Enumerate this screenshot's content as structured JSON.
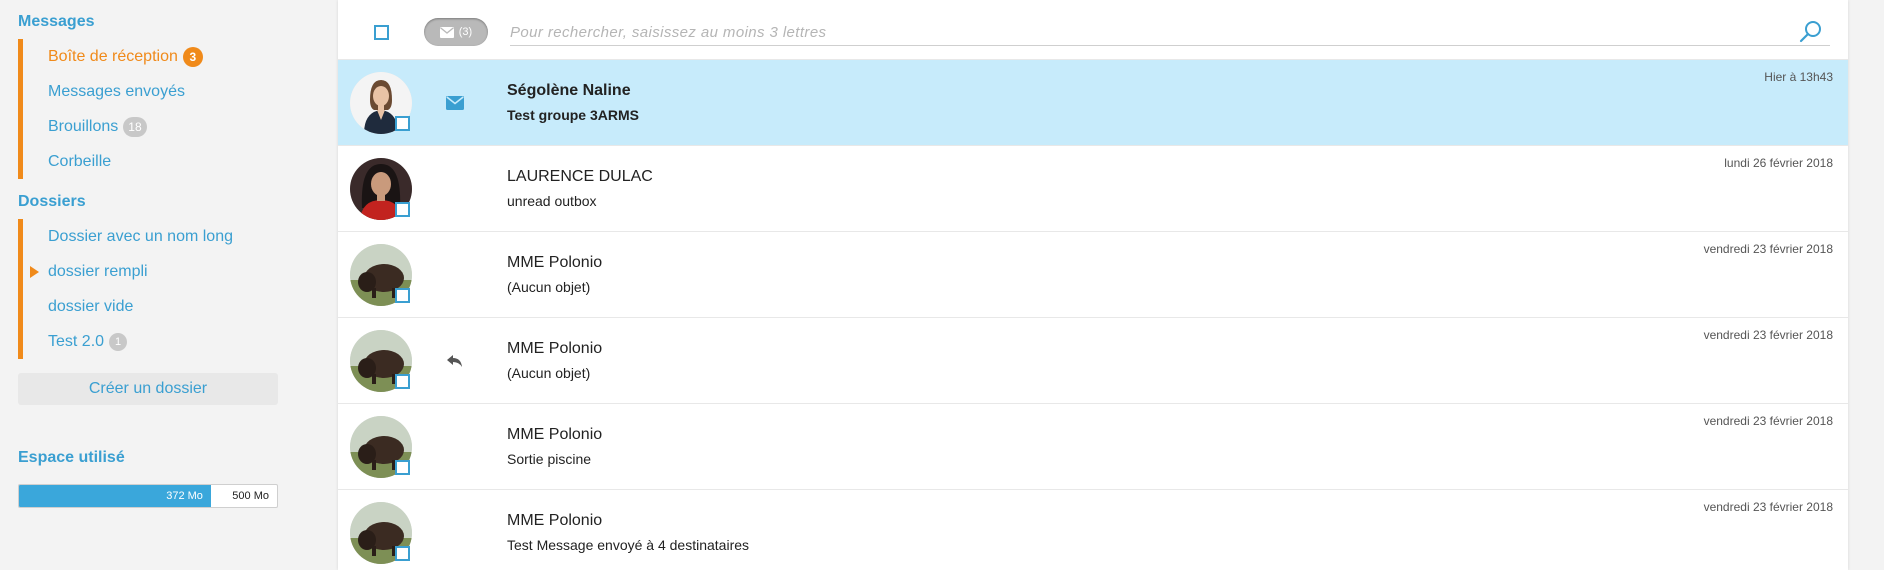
{
  "sidebar": {
    "messages_title": "Messages",
    "mail_items": [
      {
        "label": "Boîte de réception",
        "badge": "3"
      },
      {
        "label": "Messages envoyés",
        "badge": ""
      },
      {
        "label": "Brouillons",
        "badge": "18"
      },
      {
        "label": "Corbeille",
        "badge": ""
      }
    ],
    "folders_title": "Dossiers",
    "folder_items": [
      {
        "label": "Dossier avec un nom long",
        "badge": ""
      },
      {
        "label": "dossier rempli",
        "badge": ""
      },
      {
        "label": "dossier vide",
        "badge": ""
      },
      {
        "label": "Test 2.0",
        "badge": "1"
      }
    ],
    "create_folder_label": "Créer un dossier",
    "space_title": "Espace utilisé",
    "quota": {
      "used_label": "372 Mo",
      "total_label": "500 Mo",
      "used_fraction": 0.744
    }
  },
  "toolbar": {
    "unread_count": "(3)",
    "search_placeholder": "Pour rechercher, saisissez au moins 3 lettres",
    "search_value": ""
  },
  "messages": [
    {
      "sender": "Ségolène Naline",
      "subject": "Test groupe 3ARMS",
      "date": "Hier à 13h43",
      "status_icon": "envelope-icon",
      "avatar": "woman-portrait",
      "unread": true,
      "selected": true
    },
    {
      "sender": "LAURENCE DULAC",
      "subject": "unread outbox",
      "date": "lundi 26 février 2018",
      "status_icon": "",
      "avatar": "woman-dark-hair",
      "unread": false,
      "selected": false
    },
    {
      "sender": "MME Polonio",
      "subject": "(Aucun objet)",
      "date": "vendredi 23 février 2018",
      "status_icon": "",
      "avatar": "bison",
      "unread": false,
      "selected": false
    },
    {
      "sender": "MME Polonio",
      "subject": "(Aucun objet)",
      "date": "vendredi 23 février 2018",
      "status_icon": "reply-icon",
      "avatar": "bison",
      "unread": false,
      "selected": false
    },
    {
      "sender": "MME Polonio",
      "subject": "Sortie piscine",
      "date": "vendredi 23 février 2018",
      "status_icon": "",
      "avatar": "bison",
      "unread": false,
      "selected": false
    },
    {
      "sender": "MME Polonio",
      "subject": "Test Message envoyé à 4 destinataires",
      "date": "vendredi 23 février 2018",
      "status_icon": "",
      "avatar": "bison",
      "unread": false,
      "selected": false
    }
  ],
  "colors": {
    "accent_blue": "#3a9fd1",
    "accent_orange": "#f08a1a",
    "selected_row": "#c7ebfb",
    "quota_fill": "#3aa7db"
  }
}
